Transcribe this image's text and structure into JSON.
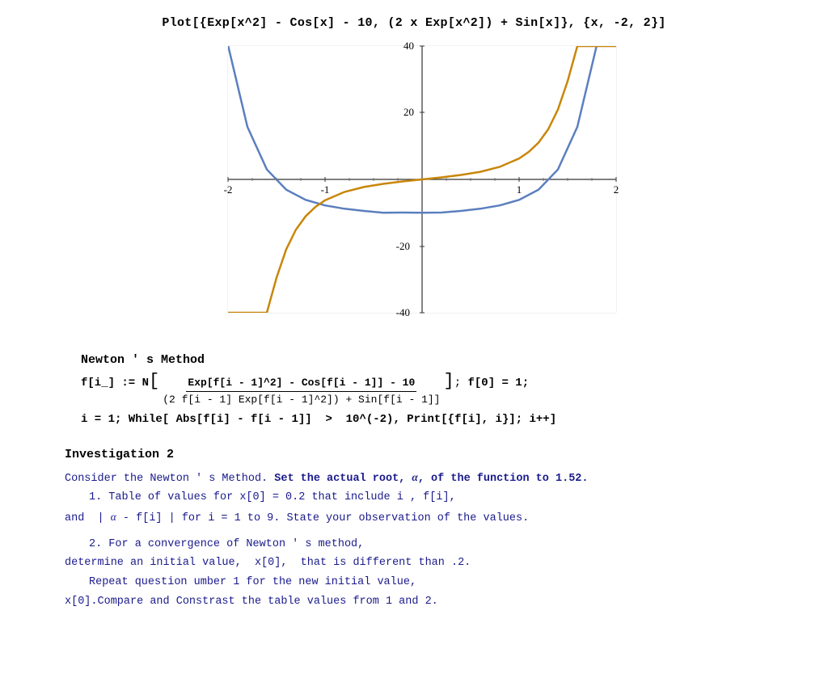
{
  "title": "Plot[{Exp[x^2] - Cos[x] - 10,  (2 x Exp[x^2]) + Sin[x]}, {x, -2, 2}]",
  "section": {
    "newton_title": "Newton ' s Method",
    "code_lines": [
      "f[i_] := N[f[i - 1] - Exp[f[i-1]^2] - Cos[f[i-1]] - 10 / (2 f[i-1] Exp[f[i-1]^2]) + Sin[f[i-1]]]; f[0] = 1;",
      "i = 1; While[ Abs[f[i] - f[i-1]] > 10^(-2), Print[{f[i], i}]; i++]"
    ]
  },
  "investigation": {
    "title": "Investigation 2",
    "line1": "Consider the Newton ' s Method. Set the actual root, α, of the function to 1.52.",
    "line2": "    1. Table of values for x[0] = 0.2 that include i , f[i],",
    "line3": "and  | α - f[i] | for i = 1 to 9. State your observation of the values.",
    "line4": "    2. For a convergence of Newton ' s method,",
    "line5": "determine an initial value,  x[0],  that is different than .2.",
    "line6": "    Repeat question umber 1 for the new initial value,",
    "line7": "x[0].Compare and Constrast the table values from 1 and 2."
  },
  "plot": {
    "x_min": -2,
    "x_max": 2,
    "y_min": -40,
    "y_max": 40,
    "x_ticks": [
      -2,
      -1,
      1,
      2
    ],
    "y_ticks": [
      -40,
      -20,
      20,
      40
    ],
    "blue_color": "#5b7fbe",
    "orange_color": "#c8860a"
  }
}
